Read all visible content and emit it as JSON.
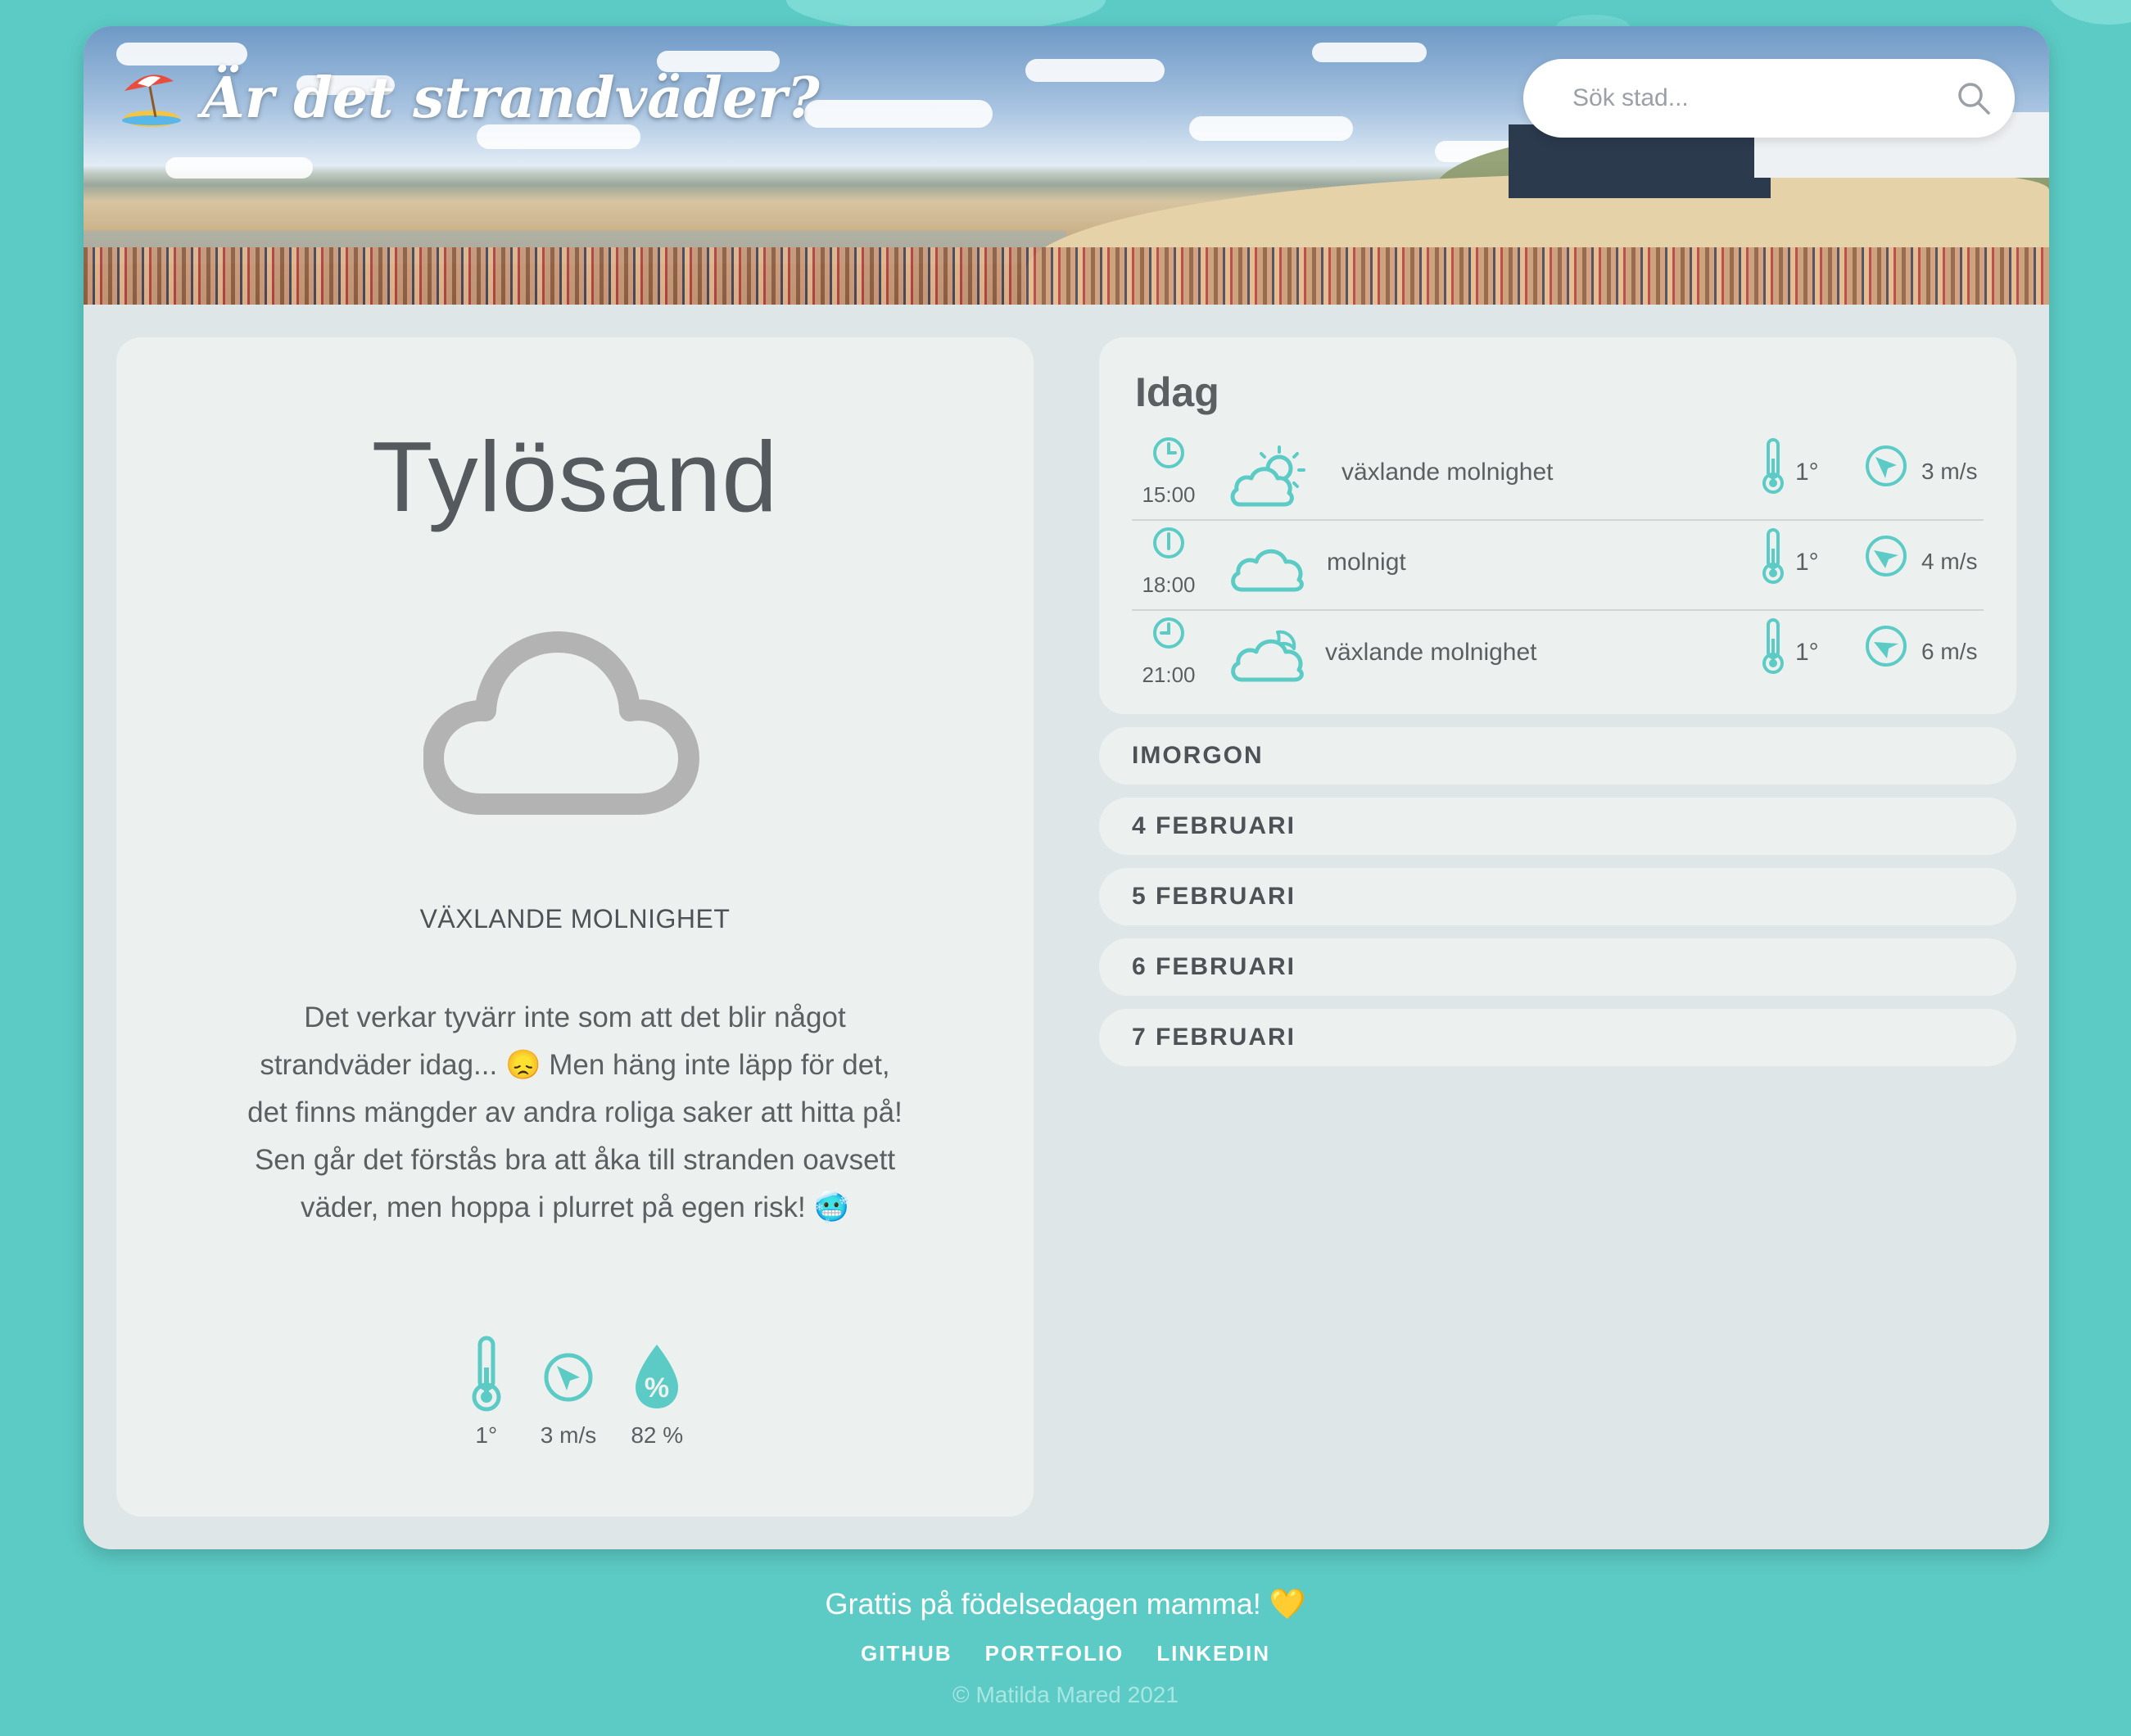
{
  "header": {
    "title": "Är det strandväder?",
    "search_placeholder": "Sök stad..."
  },
  "current": {
    "city": "Tylösand",
    "condition": "VÄXLANDE MOLNIGHET",
    "message": "Det verkar tyvärr inte som att det blir något strandväder idag... 😞 Men häng inte läpp för det, det finns mängder av andra roliga saker att hitta på! Sen går det förstås bra att åka till stranden oavsett väder, men hoppa i plurret på egen risk! 🥶",
    "temperature": "1°",
    "wind": "3 m/s",
    "humidity": "82 %"
  },
  "today": {
    "title": "Idag",
    "rows": [
      {
        "time": "15:00",
        "icon": "partly-cloudy-sun-icon",
        "description": "växlande molnighet",
        "temperature": "1°",
        "wind": "3 m/s"
      },
      {
        "time": "18:00",
        "icon": "cloud-icon",
        "description": "molnigt",
        "temperature": "1°",
        "wind": "4 m/s"
      },
      {
        "time": "21:00",
        "icon": "partly-cloudy-moon-icon",
        "description": "växlande molnighet",
        "temperature": "1°",
        "wind": "6 m/s"
      }
    ]
  },
  "days": [
    "IMORGON",
    "4 FEBRUARI",
    "5 FEBRUARI",
    "6 FEBRUARI",
    "7 FEBRUARI"
  ],
  "footer": {
    "message": "Grattis på födelsedagen mamma! 💛",
    "links": [
      "GITHUB",
      "PORTFOLIO",
      "LINKEDIN"
    ],
    "copyright": "© Matilda Mared 2021"
  },
  "colors": {
    "accent": "#5ccbc5",
    "card": "#ecf1f0",
    "panel": "#dfe6e7",
    "text": "#5b5f62"
  }
}
